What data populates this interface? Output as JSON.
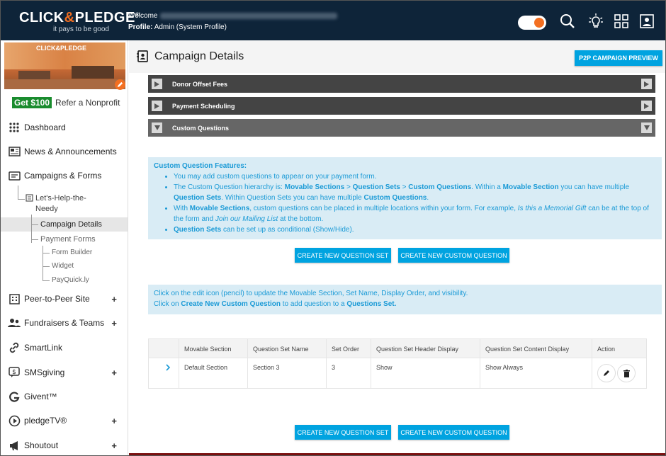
{
  "brand": {
    "logo_left": "CLICK",
    "logo_amp": "&",
    "logo_right": "PLEDGE",
    "reg": "®",
    "tagline": "it pays to be good"
  },
  "header": {
    "welcome_label": "Welcome",
    "profile_label": "Profile:",
    "profile_value": "Admin (System Profile)"
  },
  "sidebar": {
    "promo_sign": "CLICK&PLEDGE",
    "get100_badge": "Get $100",
    "get100_text": "Refer a Nonprofit",
    "items": [
      {
        "label": "Dashboard"
      },
      {
        "label": "News & Announcements"
      },
      {
        "label": "Campaigns & Forms"
      },
      {
        "label": "Peer-to-Peer Site",
        "plus": "+"
      },
      {
        "label": "Fundraisers & Teams",
        "plus": "+"
      },
      {
        "label": "SmartLink"
      },
      {
        "label": "SMSgiving",
        "plus": "+"
      },
      {
        "label": "Givent™"
      },
      {
        "label": "pledgeTV®",
        "plus": "+"
      },
      {
        "label": "Shoutout",
        "plus": "+"
      }
    ],
    "campaign": {
      "line1": "Let's-Help-the-",
      "line2": "Needy"
    },
    "sub": {
      "campaign_details": "Campaign Details",
      "payment_forms": "Payment Forms",
      "form_builder": "Form Builder",
      "widget": "Widget",
      "payquickly": "PayQuick.ly"
    }
  },
  "main": {
    "title": "Campaign Details",
    "p2p_button": "P2P CAMPAIGN PREVIEW",
    "accordions": [
      "Donor Offset Fees",
      "Payment Scheduling",
      "Custom Questions"
    ],
    "features": {
      "heading": "Custom Question Features:",
      "b1": "You may add custom questions to appear on your payment form.",
      "b2_a": "The Custom Question hierarchy is: ",
      "b2_ms": "Movable Sections",
      "b2_gt1": " > ",
      "b2_qs": "Question Sets",
      "b2_gt2": " > ",
      "b2_cq": "Custom Questions",
      "b2_b": ". Within a ",
      "b2_ms2": "Movable Section",
      "b2_c": " you can have multiple ",
      "b2_qs2": "Question Sets",
      "b2_d": ". Within Question Sets you can have multiple ",
      "b2_cq2": "Custom Questions",
      "b2_e": ".",
      "b3_a": "With ",
      "b3_ms": "Movable Sections",
      "b3_b": ", custom questions can be placed in multiple locations within your form. For example, ",
      "b3_i1": "Is this a Memorial Gift",
      "b3_c": " can be at the top of the form and ",
      "b3_i2": "Join our Mailing List",
      "b3_d": " at the bottom.",
      "b4_qs": "Question Sets",
      "b4_a": " can be set up as conditional (Show/Hide)."
    },
    "btn_new_set": "CREATE NEW QUESTION SET",
    "btn_new_question": "CREATE NEW CUSTOM QUESTION",
    "edit_info": {
      "line1": "Click on the edit icon (pencil) to update the Movable Section, Set Name, Display Order, and visibility.",
      "line2_a": "Click on ",
      "line2_b": "Create New Custom Question",
      "line2_c": " to add question to a ",
      "line2_d": "Questions Set."
    },
    "table": {
      "columns": [
        "Movable Section",
        "Question Set Name",
        "Set Order",
        "Question Set Header Display",
        "Question Set Content Display",
        "Action"
      ],
      "rows": [
        [
          "Default Section",
          "Section 3",
          "3",
          "Show",
          "Show Always"
        ]
      ]
    }
  },
  "colors": {
    "navy": "#0e2439",
    "accent": "#00a3e0",
    "orange": "#f36f21"
  }
}
